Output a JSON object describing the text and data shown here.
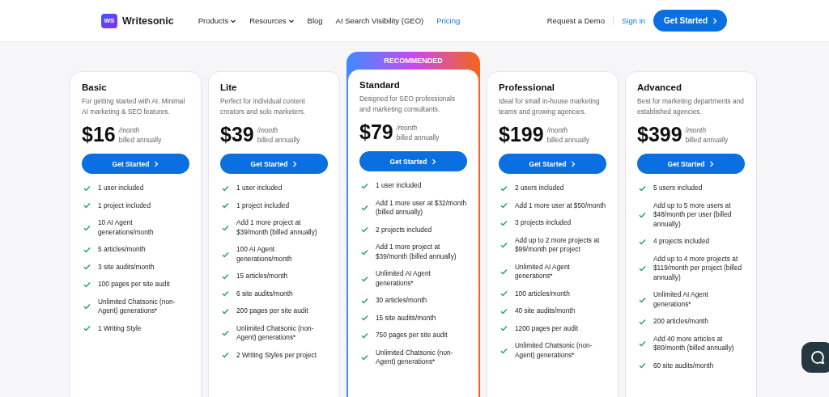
{
  "header": {
    "logo": "Writesonic",
    "logo_mark": "WS",
    "nav": [
      {
        "label": "Products",
        "dropdown": true,
        "selected": false
      },
      {
        "label": "Resources",
        "dropdown": true,
        "selected": false
      },
      {
        "label": "Blog",
        "dropdown": false,
        "selected": false
      },
      {
        "label": "AI Search Visibility (GEO)",
        "dropdown": false,
        "selected": false
      },
      {
        "label": "Pricing",
        "dropdown": false,
        "selected": true
      }
    ],
    "request_demo": "Request a Demo",
    "sign_in": "Sign in",
    "cta": "Get Started"
  },
  "plans": [
    {
      "name": "Basic",
      "recommended": false,
      "description": "For getting started with AI. Minimal AI marketing & SEO features.",
      "price": "$16",
      "period": "/month",
      "billing": "billed annually",
      "button": "Get Started",
      "features": [
        "1 user included",
        "1 project included",
        "10 AI Agent generations/month",
        "5 articles/month",
        "3 site audits/month",
        "100 pages per site audit",
        "Unlimited Chatsonic (non-Agent) generations*",
        "1 Writing Style"
      ]
    },
    {
      "name": "Lite",
      "recommended": false,
      "description": "Perfect for individual content creators and solo marketers.",
      "price": "$39",
      "period": "/month",
      "billing": "billed annually",
      "button": "Get Started",
      "features": [
        "1 user included",
        "1 project included",
        "Add 1 more project at $39/month (billed annually)",
        "100 AI Agent generations/month",
        "15 articles/month",
        "6 site audits/month",
        "200 pages per site audit",
        "Unlimited Chatsonic (non-Agent) generations*",
        "2 Writing Styles per project"
      ]
    },
    {
      "name": "Standard",
      "recommended": true,
      "badge": "RECOMMENDED",
      "description": "Designed for SEO professionals and marketing consultants.",
      "price": "$79",
      "period": "/month",
      "billing": "billed annually",
      "button": "Get Started",
      "features": [
        "1 user included",
        "Add 1 more user at $32/month (billed annually)",
        "2 projects included",
        "Add 1 more project at $39/month (billed annually)",
        "Unlimited AI Agent generations*",
        "30 articles/month",
        "15 site audits/month",
        "750 pages per site audit",
        "Unlimited Chatsonic (non-Agent) generations*"
      ]
    },
    {
      "name": "Professional",
      "recommended": false,
      "description": "Ideal for small in-house marketing teams and growing agencies.",
      "price": "$199",
      "period": "/month",
      "billing": "billed annually",
      "button": "Get Started",
      "features": [
        "2 users included",
        "Add 1 more user at $50/month",
        "3 projects included",
        "Add up to 2 more projects at $99/month per project",
        "Unlimited AI Agent generations*",
        "100 articles/month",
        "40 site audits/month",
        "1200 pages per audit",
        "Unlimited Chatsonic (non-Agent) generations*"
      ]
    },
    {
      "name": "Advanced",
      "recommended": false,
      "description": "Best for marketing departments and established agencies.",
      "price": "$399",
      "period": "/month",
      "billing": "billed annually",
      "button": "Get Started",
      "features": [
        "5 users included",
        "Add up to 5 more users at $48/month per user (billed annually)",
        "4 projects included",
        "Add up to 4 more projects at $119/month per project (billed annually)",
        "Unlimited AI Agent generations*",
        "200 articles/month",
        "Add 40 more articles at $80/month (billed annually)",
        "60 site audits/month"
      ]
    }
  ]
}
